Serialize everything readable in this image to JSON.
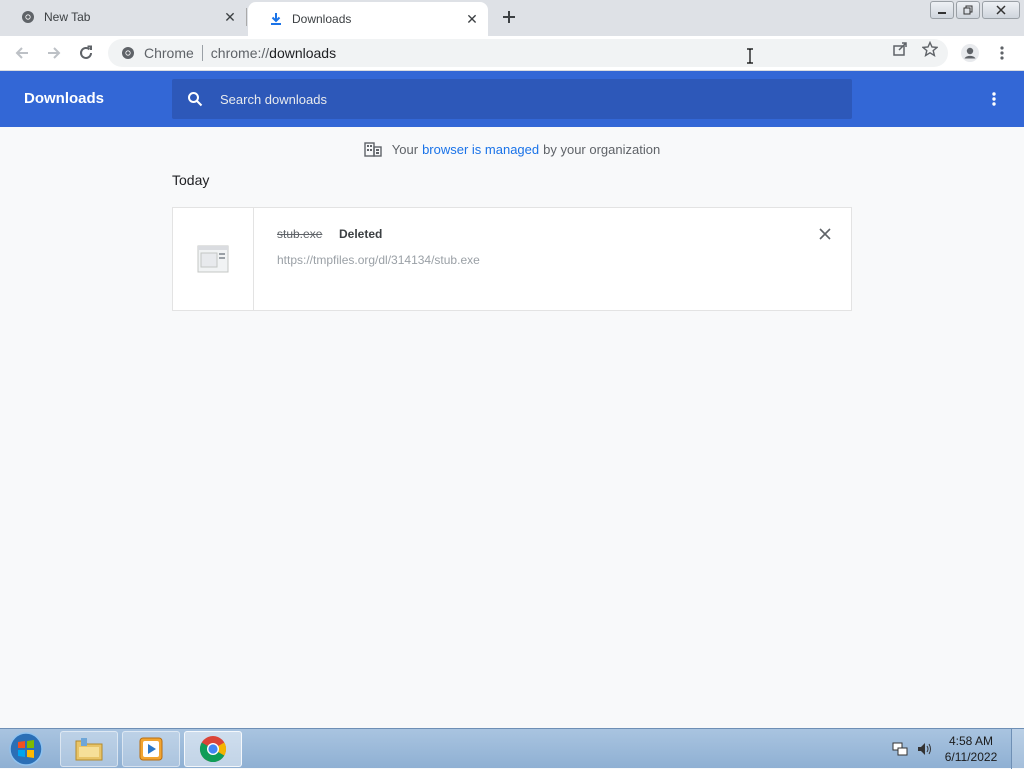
{
  "tabs": [
    {
      "title": "New Tab",
      "icon": "chrome-icon",
      "active": false
    },
    {
      "title": "Downloads",
      "icon": "download-icon",
      "active": true
    }
  ],
  "toolbar": {
    "site_name": "Chrome",
    "url_scheme": "chrome://",
    "url_host": "downloads"
  },
  "header": {
    "title": "Downloads",
    "search_placeholder": "Search downloads"
  },
  "managed_notice": {
    "prefix": "Your",
    "link": "browser is managed",
    "suffix": "by your organization"
  },
  "section_date": "Today",
  "downloads": [
    {
      "file_name": "stub.exe",
      "status": "Deleted",
      "url": "https://tmpfiles.org/dl/314134/stub.exe"
    }
  ],
  "taskbar": {
    "time": "4:58 AM",
    "date": "6/11/2022"
  },
  "colors": {
    "header_blue": "#3367d6",
    "search_blue": "#2d58b9",
    "link_blue": "#1a73e8"
  }
}
